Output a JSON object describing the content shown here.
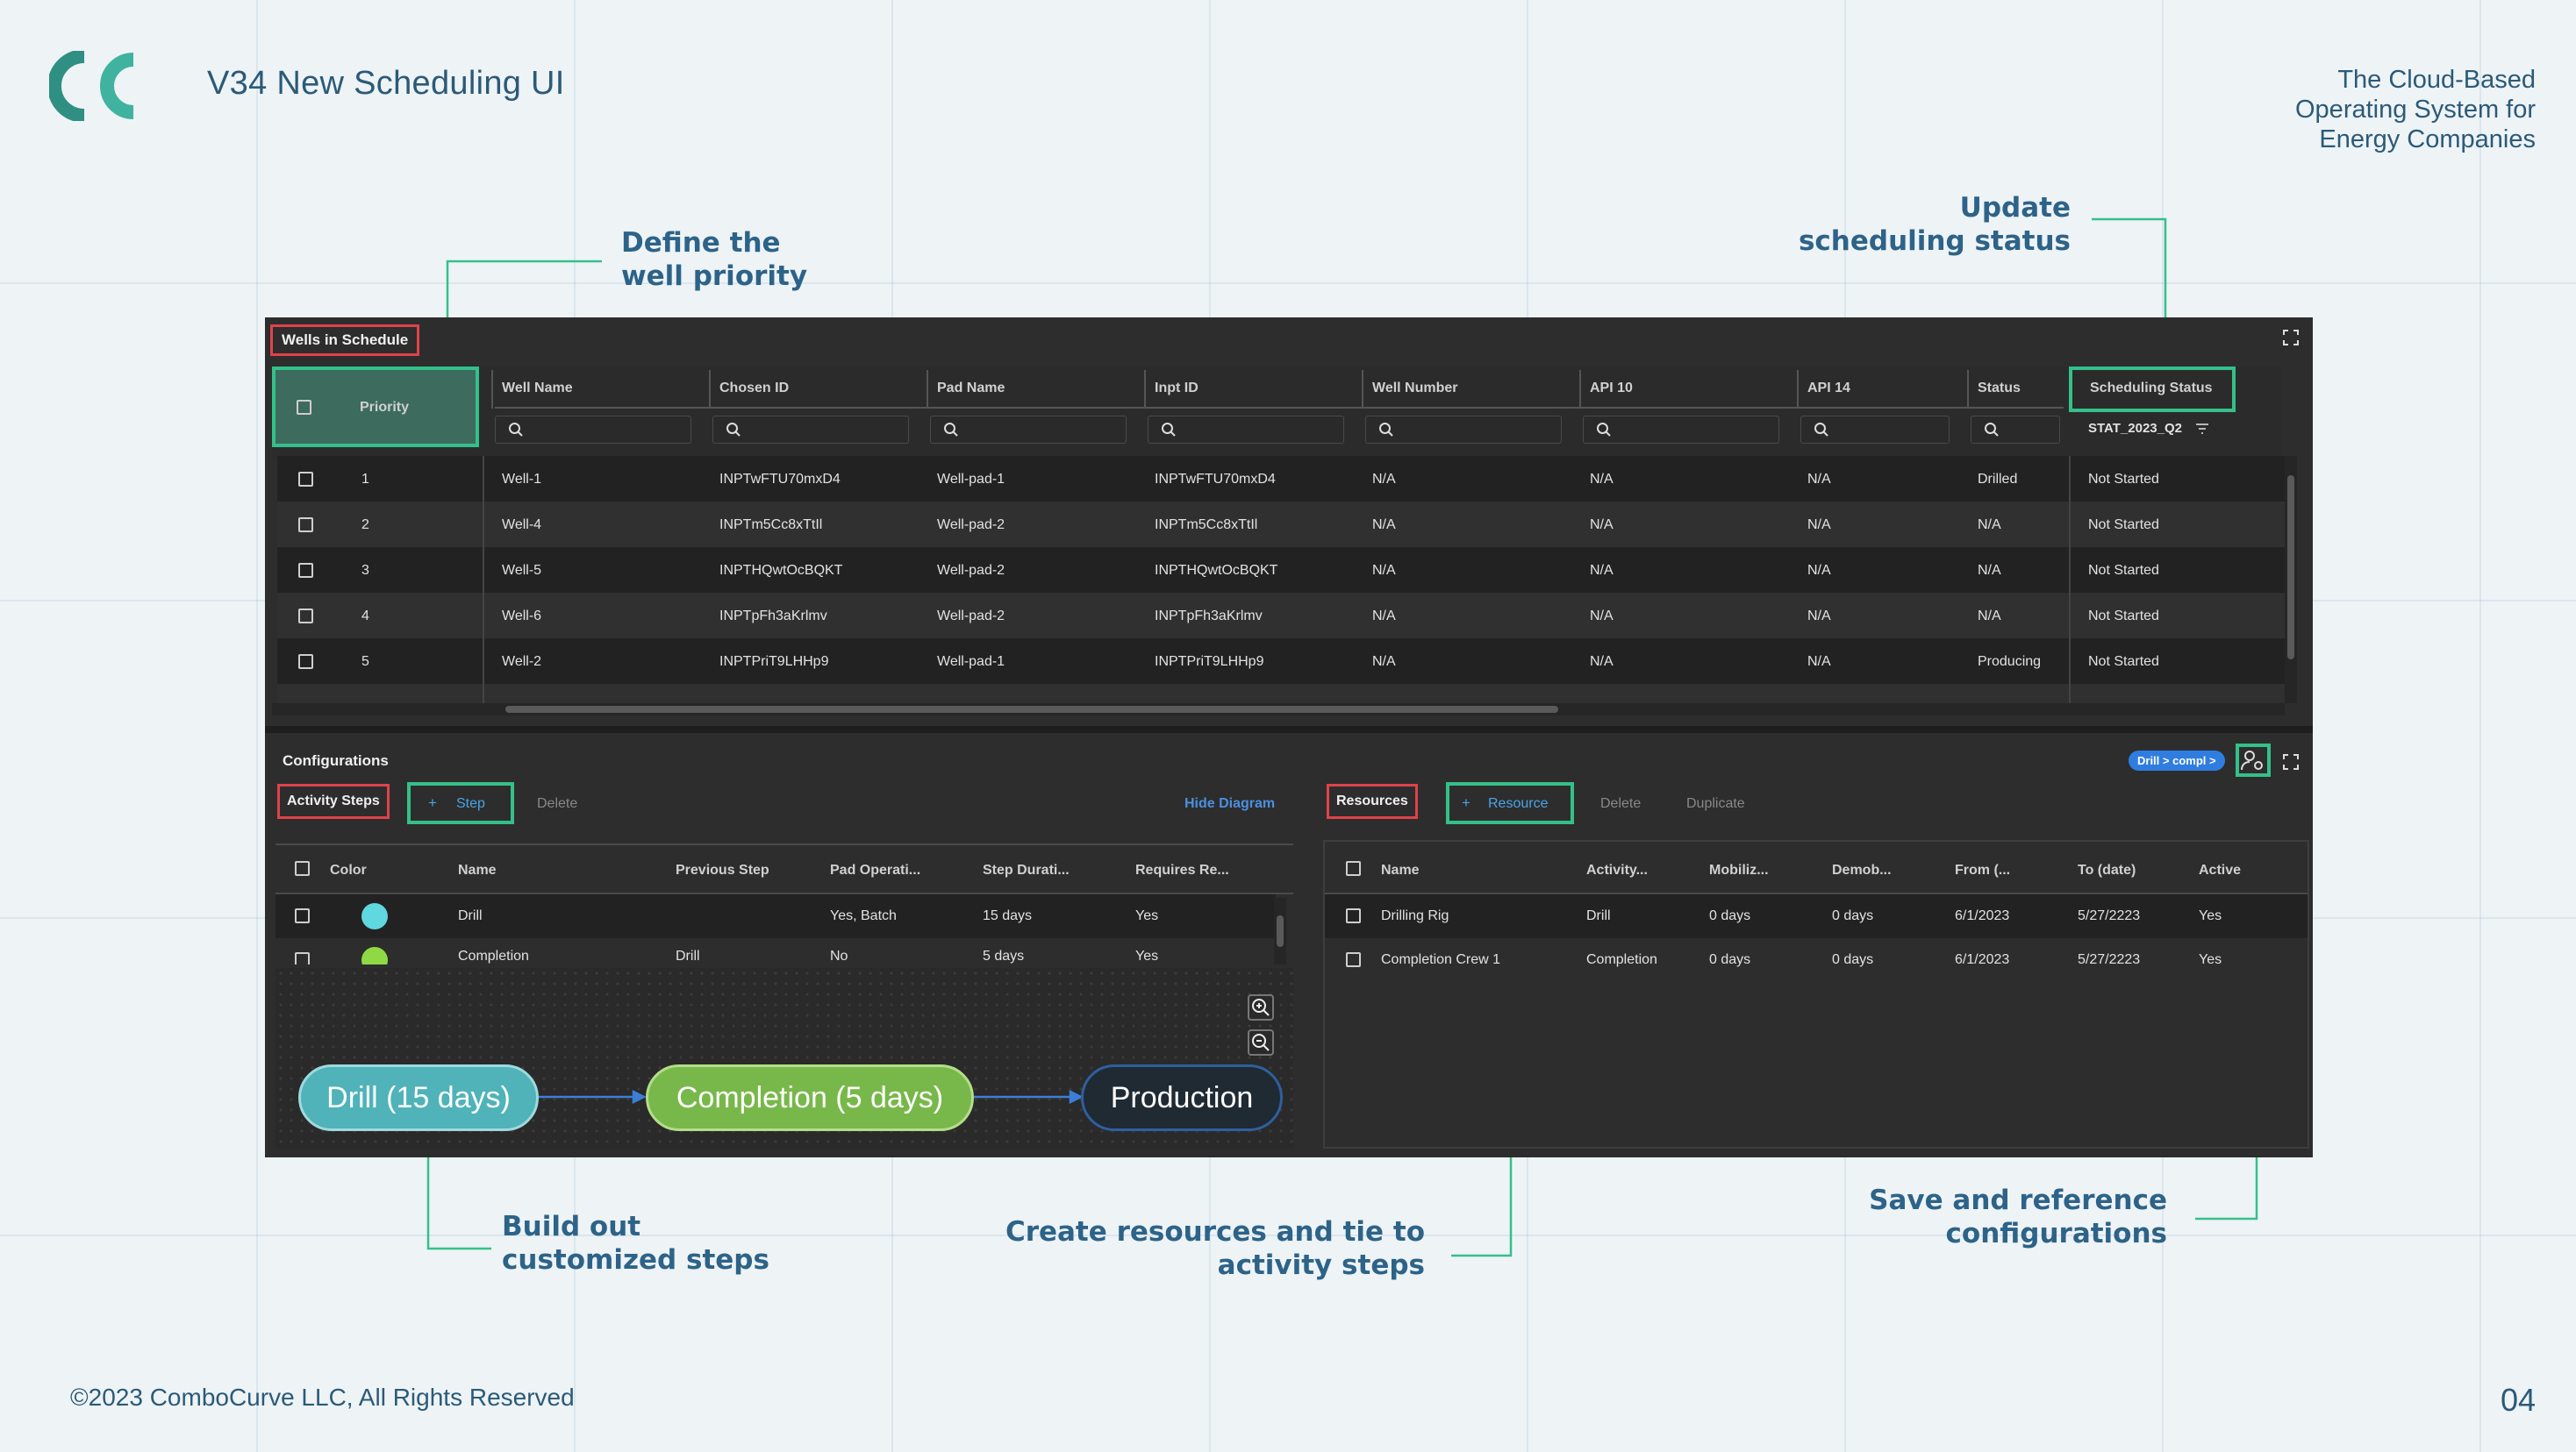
{
  "slide": {
    "title": "V34 New Scheduling UI",
    "tagline": [
      "The Cloud-Based",
      "Operating System for",
      "Energy Companies"
    ],
    "footer": "©2023 ComboCurve LLC, All Rights Reserved",
    "page_number": "04"
  },
  "callouts": {
    "priority": [
      "Define the",
      "well priority"
    ],
    "status": [
      "Update",
      "scheduling status"
    ],
    "steps": [
      "Build out",
      "customized steps"
    ],
    "resources": [
      "Create resources and tie to",
      "activity steps"
    ],
    "configs": [
      "Save and reference",
      "configurations"
    ]
  },
  "colors": {
    "accent_green": "#34c08a",
    "highlight_red": "#e0424a",
    "callout_text": "#2d6388",
    "app_bg": "#2d2d2d",
    "link_blue": "#4a90e2"
  },
  "wells": {
    "panel_title": "Wells in Schedule",
    "columns": [
      "Priority",
      "Well Name",
      "Chosen ID",
      "Pad Name",
      "Inpt ID",
      "Well Number",
      "API 10",
      "API 14",
      "Status",
      "Scheduling Status"
    ],
    "scheduling_filter": "STAT_2023_Q2",
    "rows": [
      {
        "priority": "1",
        "well_name": "Well-1",
        "chosen_id": "INPTwFTU70mxD4",
        "pad_name": "Well-pad-1",
        "inpt_id": "INPTwFTU70mxD4",
        "well_number": "N/A",
        "api10": "N/A",
        "api14": "N/A",
        "status": "Drilled",
        "scheduling_status": "Not Started"
      },
      {
        "priority": "2",
        "well_name": "Well-4",
        "chosen_id": "INPTm5Cc8xTtIl",
        "pad_name": "Well-pad-2",
        "inpt_id": "INPTm5Cc8xTtIl",
        "well_number": "N/A",
        "api10": "N/A",
        "api14": "N/A",
        "status": "N/A",
        "scheduling_status": "Not Started"
      },
      {
        "priority": "3",
        "well_name": "Well-5",
        "chosen_id": "INPTHQwtOcBQKT",
        "pad_name": "Well-pad-2",
        "inpt_id": "INPTHQwtOcBQKT",
        "well_number": "N/A",
        "api10": "N/A",
        "api14": "N/A",
        "status": "N/A",
        "scheduling_status": "Not Started"
      },
      {
        "priority": "4",
        "well_name": "Well-6",
        "chosen_id": "INPTpFh3aKrlmv",
        "pad_name": "Well-pad-2",
        "inpt_id": "INPTpFh3aKrlmv",
        "well_number": "N/A",
        "api10": "N/A",
        "api14": "N/A",
        "status": "N/A",
        "scheduling_status": "Not Started"
      },
      {
        "priority": "5",
        "well_name": "Well-2",
        "chosen_id": "INPTPriT9LHHp9",
        "pad_name": "Well-pad-1",
        "inpt_id": "INPTPriT9LHHp9",
        "well_number": "N/A",
        "api10": "N/A",
        "api14": "N/A",
        "status": "Producing",
        "scheduling_status": "Not Started"
      }
    ]
  },
  "configurations": {
    "title": "Configurations",
    "badge": "Drill > compl >",
    "activity": {
      "tab": "Activity Steps",
      "add_label": "Step",
      "delete_label": "Delete",
      "hide_label": "Hide Diagram",
      "columns": [
        "Color",
        "Name",
        "Previous Step",
        "Pad Operati...",
        "Step Durati...",
        "Requires Re..."
      ],
      "rows": [
        {
          "color": "#5fd8e0",
          "name": "Drill",
          "previous": "",
          "pad_op": "Yes, Batch",
          "duration": "15 days",
          "requires": "Yes"
        },
        {
          "color": "#8fd944",
          "name": "Completion",
          "previous": "Drill",
          "pad_op": "No",
          "duration": "5 days",
          "requires": "Yes"
        }
      ],
      "diagram": [
        {
          "label": "Drill (15 days)",
          "fill": "#4fb3b9"
        },
        {
          "label": "Completion (5 days)",
          "fill": "#78b84a"
        },
        {
          "label": "Production",
          "fill": "#1f2a33"
        }
      ]
    },
    "resources": {
      "tab": "Resources",
      "add_label": "Resource",
      "delete_label": "Delete",
      "duplicate_label": "Duplicate",
      "columns": [
        "Name",
        "Activity...",
        "Mobiliz...",
        "Demob...",
        "From (...",
        "To (date)",
        "Active"
      ],
      "rows": [
        {
          "name": "Drilling Rig",
          "activity": "Drill",
          "mobilization": "0 days",
          "demob": "0 days",
          "from": "6/1/2023",
          "to": "5/27/2223",
          "active": "Yes"
        },
        {
          "name": "Completion Crew 1",
          "activity": "Completion",
          "mobilization": "0 days",
          "demob": "0 days",
          "from": "6/1/2023",
          "to": "5/27/2223",
          "active": "Yes"
        }
      ]
    }
  }
}
